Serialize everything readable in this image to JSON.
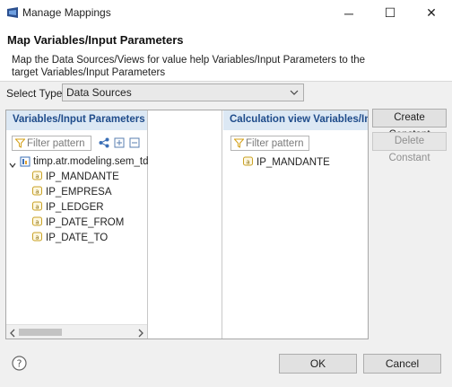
{
  "window": {
    "title": "Manage Mappings",
    "controls": {
      "minimize": "─",
      "maximize": "☐",
      "close": "✕"
    }
  },
  "header": {
    "title": "Map Variables/Input Parameters",
    "description": "Map the Data Sources/Views for value help  Variables/Input Parameters to the target Variables/Input Parameters"
  },
  "select_type": {
    "label": "Select Type",
    "value": "Data Sources"
  },
  "left_panel": {
    "header": "Variables/Input Parameters",
    "filter_placeholder": "Filter pattern",
    "tree": {
      "root": "timp.atr.modeling.sem_tdf",
      "children": [
        "IP_MANDANTE",
        "IP_EMPRESA",
        "IP_LEDGER",
        "IP_DATE_FROM",
        "IP_DATE_TO"
      ]
    }
  },
  "right_panel": {
    "header": "Calculation view Variables/In",
    "filter_placeholder": "Filter pattern",
    "items": [
      "IP_MANDANTE"
    ]
  },
  "side_buttons": {
    "create_constant": "Create Constant",
    "delete_constant": "Delete Constant"
  },
  "footer": {
    "ok": "OK",
    "cancel": "Cancel"
  },
  "colors": {
    "panel_header_bg": "#dce8f4",
    "panel_header_text": "#1e4b8a",
    "dialog_bg": "#f0f0f0"
  }
}
